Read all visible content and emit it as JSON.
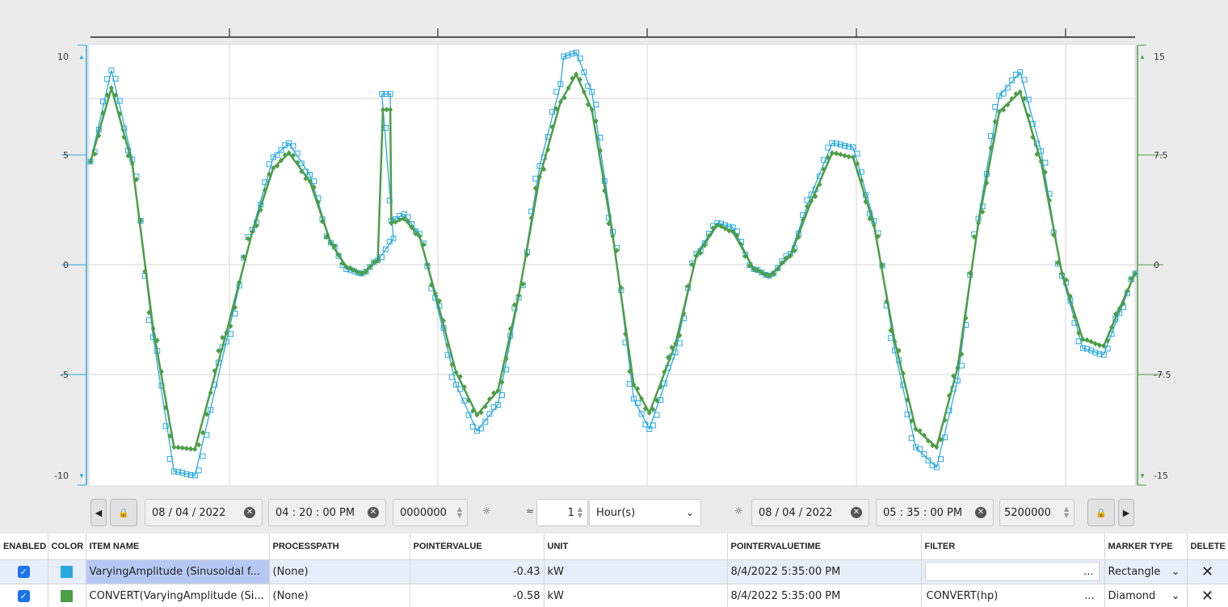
{
  "chart_data": {
    "type": "line",
    "left_axis": {
      "ticks": [
        "10",
        "5",
        "0",
        "-5",
        "-10"
      ],
      "range": [
        -10,
        10
      ],
      "color": "#29a8e0"
    },
    "right_axis": {
      "ticks": [
        "15",
        "7.5",
        "0",
        "-7.5",
        "-15"
      ],
      "range": [
        -15,
        15
      ],
      "color": "#4c9e47"
    },
    "grid": true,
    "series": [
      {
        "name": "VaryingAmplitude (Sinusoidal f...",
        "color": "#29a8e0",
        "marker": "rectangle",
        "axis": "left",
        "points": [
          [
            0,
            4.7
          ],
          [
            0.02,
            9.3
          ],
          [
            0.04,
            4.8
          ],
          [
            0.06,
            -3.3
          ],
          [
            0.08,
            -9.8
          ],
          [
            0.1,
            -10.0
          ],
          [
            0.13,
            -3.5
          ],
          [
            0.155,
            1.6
          ],
          [
            0.175,
            4.9
          ],
          [
            0.19,
            5.6
          ],
          [
            0.21,
            4.1
          ],
          [
            0.23,
            1.0
          ],
          [
            0.245,
            -0.2
          ],
          [
            0.26,
            -0.4
          ],
          [
            0.275,
            0.2
          ],
          [
            0.29,
            1.2
          ],
          [
            0.279,
            8.1
          ],
          [
            0.287,
            8.1
          ],
          [
            0.288,
            2.0
          ],
          [
            0.3,
            2.3
          ],
          [
            0.315,
            1.4
          ],
          [
            0.33,
            -1.5
          ],
          [
            0.35,
            -5.5
          ],
          [
            0.37,
            -7.8
          ],
          [
            0.39,
            -6.5
          ],
          [
            0.41,
            -1.5
          ],
          [
            0.43,
            4.5
          ],
          [
            0.45,
            8.6
          ],
          [
            0.453,
            10.0
          ],
          [
            0.465,
            10.2
          ],
          [
            0.48,
            8.2
          ],
          [
            0.5,
            1.5
          ],
          [
            0.52,
            -6.2
          ],
          [
            0.535,
            -7.7
          ],
          [
            0.56,
            -4.0
          ],
          [
            0.58,
            0.5
          ],
          [
            0.6,
            1.9
          ],
          [
            0.615,
            1.7
          ],
          [
            0.635,
            -0.2
          ],
          [
            0.65,
            -0.5
          ],
          [
            0.67,
            0.5
          ],
          [
            0.69,
            3.2
          ],
          [
            0.71,
            5.6
          ],
          [
            0.73,
            5.4
          ],
          [
            0.75,
            2.0
          ],
          [
            0.77,
            -3.9
          ],
          [
            0.79,
            -8.6
          ],
          [
            0.81,
            -9.6
          ],
          [
            0.83,
            -5.3
          ],
          [
            0.85,
            2.1
          ],
          [
            0.87,
            8.0
          ],
          [
            0.89,
            9.2
          ],
          [
            0.91,
            5.2
          ],
          [
            0.93,
            -0.5
          ],
          [
            0.95,
            -3.8
          ],
          [
            0.97,
            -4.1
          ],
          [
            0.985,
            -2.2
          ],
          [
            1.0,
            -0.4
          ]
        ]
      },
      {
        "name": "CONVERT(VaryingAmplitude (Si...",
        "color": "#4c9e47",
        "marker": "diamond",
        "axis": "right",
        "points": [
          [
            0,
            4.7
          ],
          [
            0.02,
            8.4
          ],
          [
            0.04,
            4.6
          ],
          [
            0.06,
            -2.9
          ],
          [
            0.08,
            -8.6
          ],
          [
            0.1,
            -8.7
          ],
          [
            0.13,
            -3.1
          ],
          [
            0.155,
            1.5
          ],
          [
            0.175,
            4.4
          ],
          [
            0.19,
            5.1
          ],
          [
            0.21,
            3.8
          ],
          [
            0.23,
            1.0
          ],
          [
            0.245,
            -0.1
          ],
          [
            0.26,
            -0.4
          ],
          [
            0.275,
            0.2
          ],
          [
            0.28,
            7.3
          ],
          [
            0.287,
            7.3
          ],
          [
            0.288,
            1.9
          ],
          [
            0.3,
            2.1
          ],
          [
            0.315,
            1.3
          ],
          [
            0.33,
            -1.3
          ],
          [
            0.35,
            -4.9
          ],
          [
            0.37,
            -7.0
          ],
          [
            0.39,
            -5.8
          ],
          [
            0.41,
            -1.4
          ],
          [
            0.43,
            4.0
          ],
          [
            0.45,
            7.7
          ],
          [
            0.465,
            9.1
          ],
          [
            0.48,
            7.3
          ],
          [
            0.5,
            1.3
          ],
          [
            0.52,
            -5.5
          ],
          [
            0.535,
            -6.9
          ],
          [
            0.56,
            -3.6
          ],
          [
            0.58,
            0.4
          ],
          [
            0.6,
            1.8
          ],
          [
            0.615,
            1.5
          ],
          [
            0.635,
            -0.2
          ],
          [
            0.65,
            -0.5
          ],
          [
            0.67,
            0.4
          ],
          [
            0.69,
            2.9
          ],
          [
            0.71,
            5.1
          ],
          [
            0.73,
            4.9
          ],
          [
            0.75,
            1.8
          ],
          [
            0.77,
            -3.5
          ],
          [
            0.79,
            -7.7
          ],
          [
            0.81,
            -8.6
          ],
          [
            0.83,
            -4.7
          ],
          [
            0.85,
            1.9
          ],
          [
            0.87,
            7.2
          ],
          [
            0.89,
            8.2
          ],
          [
            0.91,
            4.7
          ],
          [
            0.93,
            -0.4
          ],
          [
            0.95,
            -3.4
          ],
          [
            0.97,
            -3.7
          ],
          [
            0.985,
            -2.0
          ],
          [
            1.0,
            -0.4
          ]
        ]
      }
    ]
  },
  "controls": {
    "start_date": "08 / 04 / 2022",
    "start_time": "04 : 20 : 00  PM",
    "start_ms": "0000000",
    "interval_count": "1",
    "interval_unit": "Hour(s)",
    "end_date": "08 / 04 / 2022",
    "end_time": "05 : 35 : 00  PM",
    "end_ms": "5200000"
  },
  "grid": {
    "headers": [
      "ENABLED",
      "COLOR",
      "ITEM NAME",
      "PROCESSPATH",
      "POINTERVALUE",
      "UNIT",
      "POINTERVALUETIME",
      "FILTER",
      "MARKER TYPE",
      "DELETE"
    ],
    "rows": [
      {
        "color": "#29a8e0",
        "item_name": "VaryingAmplitude (Sinusoidal f...",
        "processpath": "(None)",
        "pointervalue": "-0.43",
        "unit": "kW",
        "time": "8/4/2022 5:35:00 PM",
        "filter": "",
        "filter_btn": "...",
        "marker": "Rectangle"
      },
      {
        "color": "#4c9e47",
        "item_name": "CONVERT(VaryingAmplitude (Si...",
        "processpath": "(None)",
        "pointervalue": "-0.58",
        "unit": "kW",
        "time": "8/4/2022 5:35:00 PM",
        "filter": "CONVERT(hp)",
        "filter_btn": "...",
        "marker": "Diamond"
      }
    ]
  }
}
